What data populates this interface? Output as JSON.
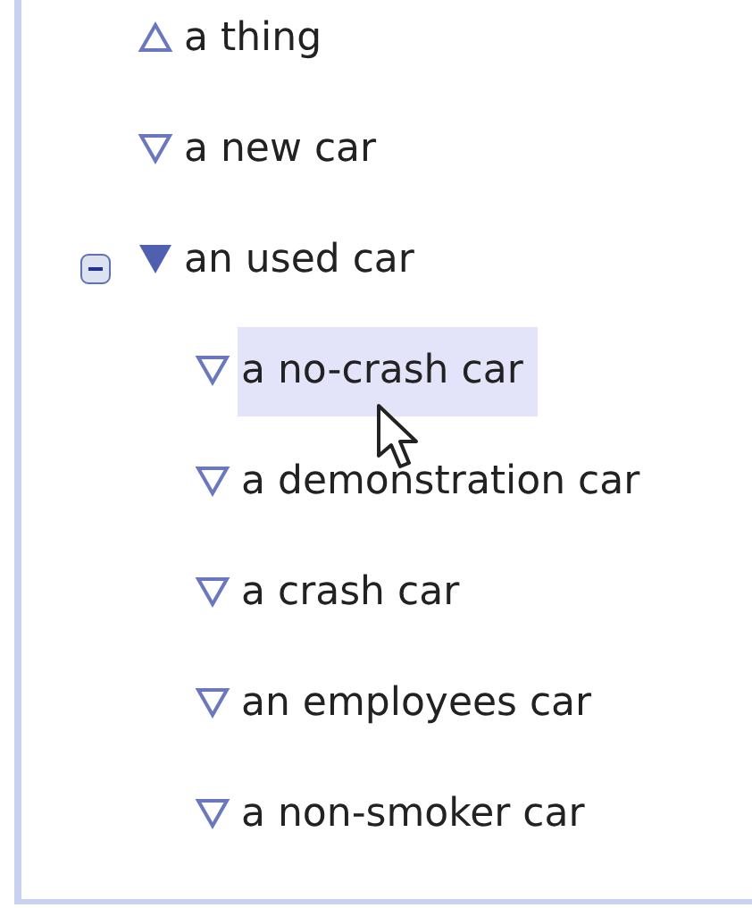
{
  "tree": {
    "items": [
      {
        "label": "a thing",
        "kind": "up",
        "selected": false
      },
      {
        "label": "a new car",
        "kind": "down",
        "selected": false
      },
      {
        "label": "an used car",
        "kind": "down-filled",
        "selected": false,
        "expanded": true,
        "children": [
          {
            "label": "a no-crash car",
            "kind": "down",
            "selected": true
          },
          {
            "label": "a demonstration car",
            "kind": "down",
            "selected": false
          },
          {
            "label": "a crash car",
            "kind": "down",
            "selected": false
          },
          {
            "label": "an employees car",
            "kind": "down",
            "selected": false
          },
          {
            "label": "a non-smoker car",
            "kind": "down",
            "selected": false
          }
        ]
      }
    ]
  }
}
